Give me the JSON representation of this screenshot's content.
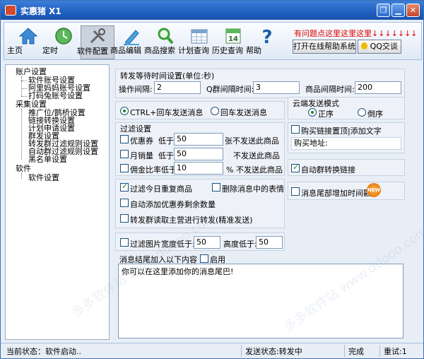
{
  "window": {
    "title": "实惠猪 X1"
  },
  "toolbar": {
    "items": [
      {
        "label": "主页",
        "icon": "home-icon"
      },
      {
        "label": "定时",
        "icon": "clock-icon"
      },
      {
        "label": "软件配置",
        "icon": "tools-icon"
      },
      {
        "label": "商品编辑",
        "icon": "pen-icon"
      },
      {
        "label": "商品搜索",
        "icon": "magnifier-icon"
      },
      {
        "label": "计划查询",
        "icon": "calendar-grid-icon"
      },
      {
        "label": "历史查询",
        "icon": "calendar-14-icon"
      },
      {
        "label": "帮助",
        "icon": "help-icon"
      }
    ],
    "calendar_day": "14",
    "notice": "有问题点这里这里这里↓↓↓↓↓↓↓",
    "help_system_button": "打开在线帮助系统",
    "qq_button": "QQ交谈"
  },
  "tree": {
    "groups": [
      {
        "label": "账户设置",
        "children": [
          "软件账号设置",
          "阿里妈妈账号设置",
          "打码兔账号设置"
        ]
      },
      {
        "label": "采集设置",
        "children": [
          "推广位/鹊桥设置",
          "链接转换设置",
          "计划申请设置",
          "群发设置",
          "转发群过滤规则设置",
          "自动群过滤规则设置",
          "黑名单设置"
        ]
      },
      {
        "label": "软件",
        "children": [
          "软件设置"
        ]
      }
    ]
  },
  "wait_settings": {
    "title": "转发等待时间设置(单位:秒)",
    "op_interval_label": "操作间隔:",
    "op_interval_value": "2",
    "q_group_interval_label": "Q群间隔时间:",
    "q_group_interval_value": "3",
    "product_interval_label": "商品间隔时间:",
    "product_interval_value": "200"
  },
  "send_mode": {
    "ctrl_enter": "CTRL+回车发送消息",
    "enter": "回车发送消息",
    "selected": "ctrl_enter"
  },
  "cloud_mode": {
    "title": "云端发送模式",
    "asc": "正序",
    "desc": "倒序",
    "selected": "asc"
  },
  "filter": {
    "title": "过滤设置",
    "rows": [
      {
        "check": "优惠券",
        "cond": "低于",
        "value": "50",
        "suffix": "张不发送此商品"
      },
      {
        "check": "月销量",
        "cond": "低于",
        "value": "50",
        "suffix": "不发送此商品"
      },
      {
        "check": "佣金比率低于",
        "cond": "",
        "value": "10",
        "suffix": "% 不发送此商品"
      }
    ]
  },
  "buy_link": {
    "check_label": "购买链接置顶|添加文字",
    "address_label": "购买地址:"
  },
  "auto_group_link": {
    "label": "自动群转换链接"
  },
  "options": {
    "filter_duplicate": "过滤今日重复商品",
    "delete_emoji": "删除消息中的表情",
    "auto_coupon_remain": "自动添加优惠券剩余数量",
    "forward_group": "转发群读取主营进行转发(精准发送)"
  },
  "tail_time": {
    "label": "消息尾部增加时间戳",
    "badge": "NEW"
  },
  "image_filter": {
    "check": "过滤图片宽度低于:",
    "width_value": "50",
    "height_label": "高度低于:",
    "height_value": "50"
  },
  "message_tail": {
    "title": "消息结尾加入以下内容",
    "enable_label": "启用",
    "content": "你可以在这里添加你的消息尾巴!"
  },
  "status": {
    "current": "当前状态：软件启动..",
    "send_status": "发送状态:转发中",
    "done": "完成",
    "retry": "重试:1"
  },
  "watermark": "多多软件站  www.ddooo.com"
}
